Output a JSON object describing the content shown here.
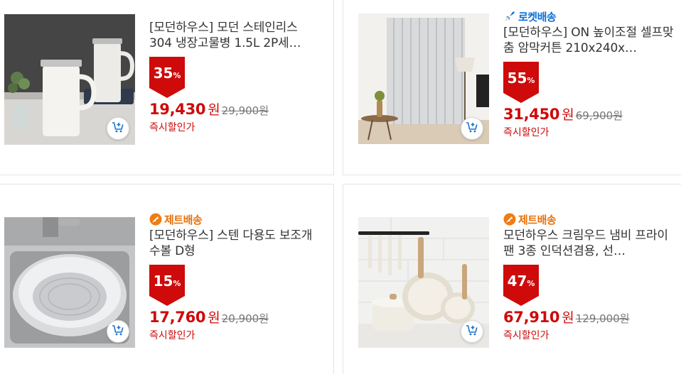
{
  "colors": {
    "accent_red": "#ce0a0a",
    "rocket_blue": "#0b6fd6",
    "jet_orange": "#e8710a"
  },
  "products": [
    {
      "title": "[모던하우스] 모던 스테인리스 304 냉장고물병 1.5L 2P세…",
      "badge": "",
      "discount": "35",
      "discount_unit": "%",
      "price": "19,430",
      "currency": "원",
      "original_price": "29,900원",
      "instant_label": "즉시할인가",
      "image": "white-water-jugs",
      "cart_icon": "add-to-cart-icon"
    },
    {
      "title": "[모던하우스] ON 높이조절 셀프맞춤 암막커튼 210x240x…",
      "badge": "로켓배송",
      "badge_icon": "rocket-icon",
      "discount": "55",
      "discount_unit": "%",
      "price": "31,450",
      "currency": "원",
      "original_price": "69,900원",
      "instant_label": "즉시할인가",
      "image": "grey-curtain-room",
      "cart_icon": "add-to-cart-icon"
    },
    {
      "title": "[모던하우스] 스텐 다용도 보조개수볼 D형",
      "badge": "제트배송",
      "badge_icon": "jet-icon",
      "discount": "15",
      "discount_unit": "%",
      "price": "17,760",
      "currency": "원",
      "original_price": "20,900원",
      "instant_label": "즉시할인가",
      "image": "stainless-sink-bowl",
      "cart_icon": "add-to-cart-icon"
    },
    {
      "title": "모던하우스 크림우드 냄비 프라이팬 3종 인덕션겸용, 선…",
      "badge": "제트배송",
      "badge_icon": "jet-icon",
      "discount": "47",
      "discount_unit": "%",
      "price": "67,910",
      "currency": "원",
      "original_price": "129,000원",
      "instant_label": "즉시할인가",
      "image": "cream-cookware-set",
      "cart_icon": "add-to-cart-icon"
    }
  ]
}
